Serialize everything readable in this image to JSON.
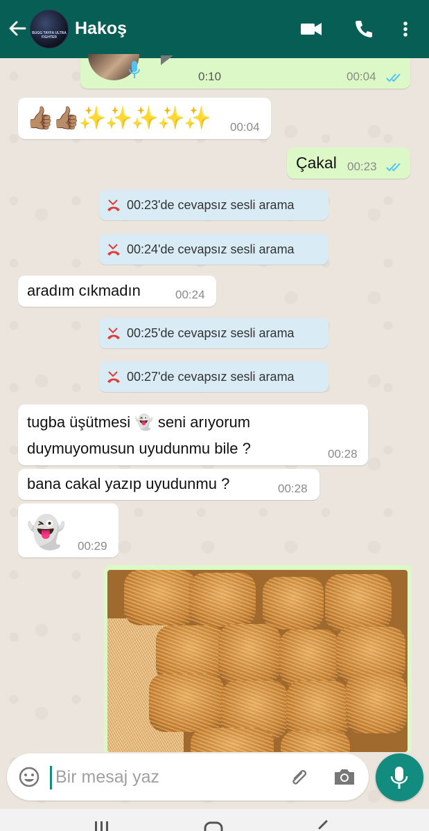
{
  "header": {
    "contact_name": "Hakoş",
    "avatar_text": "BUGG TAYFA ULTRA FIGHTER"
  },
  "messages": {
    "voice": {
      "duration": "0:10",
      "time": "00:04"
    },
    "thumbs": {
      "emoji": "👍🏽👍🏽✨✨✨✨✨",
      "time": "00:04"
    },
    "cakal": {
      "text": "Çakal",
      "time": "00:23"
    },
    "call1": {
      "text": "00:23'de cevapsız sesli arama"
    },
    "call2": {
      "text": "00:24'de cevapsız sesli arama"
    },
    "aradim": {
      "text": "aradım cıkmadın",
      "time": "00:24"
    },
    "call3": {
      "text": "00:25'de cevapsız sesli arama"
    },
    "call4": {
      "text": "00:27'de cevapsız sesli arama"
    },
    "tugba": {
      "line1": "tugba üşütmesi 👻 seni arıyorum",
      "line2": "duymuyomusun uyudunmu bile ?",
      "time": "00:28"
    },
    "bana": {
      "text": "bana cakal yazıp uyudunmu ?",
      "time": "00:28"
    },
    "ghost": {
      "emoji": "👻",
      "time": "00:29"
    }
  },
  "composer": {
    "placeholder": "Bir mesaj yaz"
  },
  "colors": {
    "header": "#075e54",
    "outgoing_bubble": "#dcf8c6",
    "incoming_bubble": "#ffffff",
    "missed_call_bubble": "#d9ecf5",
    "accent": "#128c7e",
    "missed_call_icon": "#e53935",
    "read_ticks": "#4fc3f7"
  },
  "icons": {
    "back": "arrow-left-icon",
    "video": "video-camera-icon",
    "call": "phone-icon",
    "menu": "more-vertical-icon",
    "missed_call": "missed-call-icon",
    "emoji": "smiley-icon",
    "attach": "paperclip-icon",
    "camera": "camera-icon",
    "mic": "microphone-icon"
  }
}
